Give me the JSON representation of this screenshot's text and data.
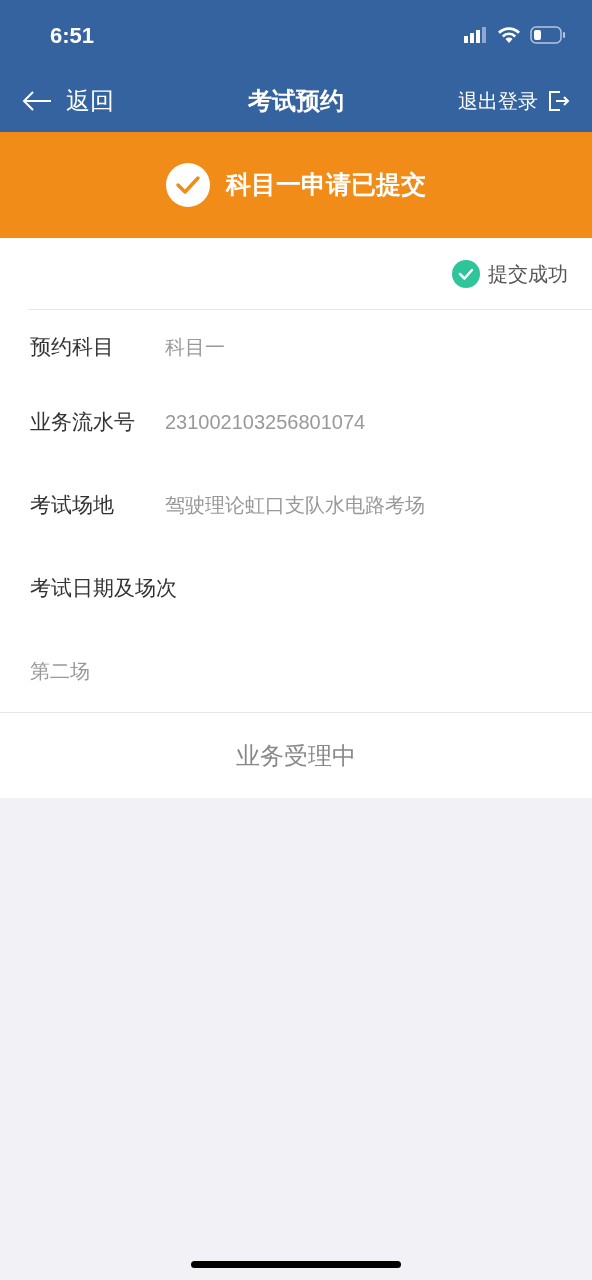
{
  "status_bar": {
    "time": "6:51"
  },
  "nav": {
    "back": "返回",
    "title": "考试预约",
    "logout": "退出登录"
  },
  "banner": {
    "text": "科目一申请已提交"
  },
  "result": {
    "text": "提交成功"
  },
  "fields": [
    {
      "label": "预约科目",
      "value": "科目一"
    },
    {
      "label": "业务流水号",
      "value": "231002103256801074"
    },
    {
      "label": "考试场地",
      "value": "驾驶理论虹口支队水电路考场"
    },
    {
      "label": "考试日期及场次"
    }
  ],
  "session": "第二场",
  "action": {
    "label": "业务受理中"
  }
}
